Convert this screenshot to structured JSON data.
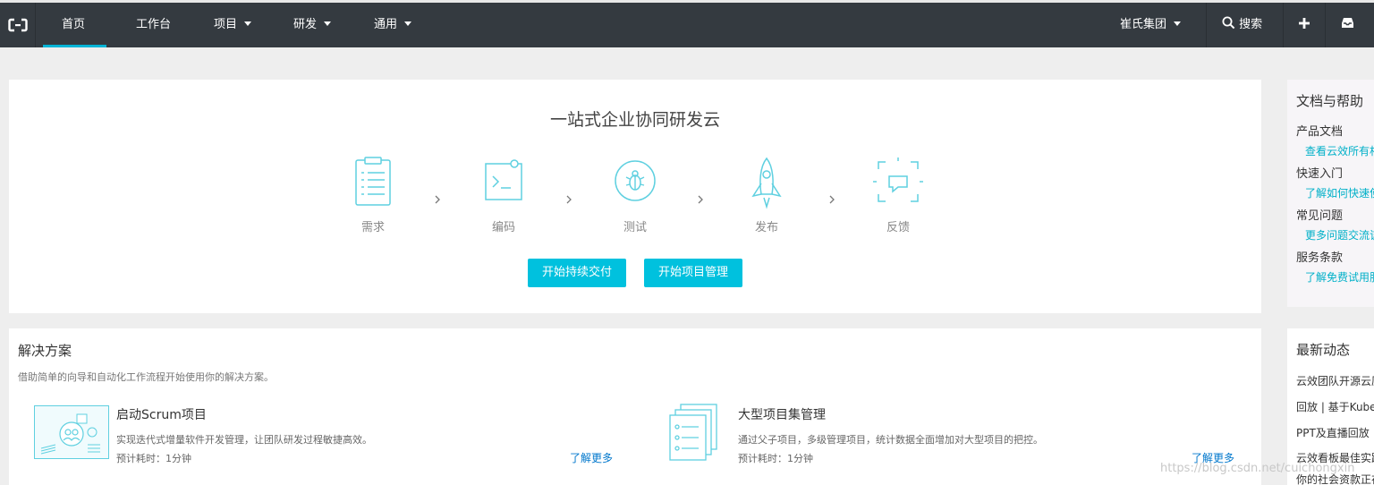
{
  "nav": {
    "items": [
      "首页",
      "工作台",
      "项目",
      "研发",
      "通用"
    ],
    "org": "崔氏集团",
    "search": "搜索"
  },
  "hero": {
    "title": "一站式企业协同研发云",
    "steps": [
      "需求",
      "编码",
      "测试",
      "发布",
      "反馈"
    ],
    "buttons": [
      "开始持续交付",
      "开始项目管理"
    ]
  },
  "solutions": {
    "title": "解决方案",
    "desc": "借助简单的向导和自动化工作流程开始使用你的解决方案。",
    "items": [
      {
        "title": "启动Scrum项目",
        "desc": "实现迭代式增量软件开发管理，让团队研发过程敏捷高效。",
        "time": "预计耗时：1分钟",
        "more": "了解更多"
      },
      {
        "title": "大型项目集管理",
        "desc": "通过父子项目，多级管理项目，统计数据全面增加对大型项目的把控。",
        "time": "预计耗时：1分钟",
        "more": "了解更多"
      }
    ]
  },
  "help": {
    "title": "文档与帮助",
    "groups": [
      {
        "heading": "产品文档",
        "link": "查看云效所有相"
      },
      {
        "heading": "快速入门",
        "link": "了解如何快速使"
      },
      {
        "heading": "常见问题",
        "link": "更多问题交流该"
      },
      {
        "heading": "服务条款",
        "link": "了解免费试用服"
      }
    ]
  },
  "news": {
    "title": "最新动态",
    "items": [
      "云效团队开源云原",
      "回放 | 基于Kubern",
      "PPT及直播回放 | ",
      "云效看板最佳实践",
      "你的社会资款正在"
    ]
  },
  "watermark": "https://blog.csdn.net/cuichongxin",
  "colors": {
    "accent": "#00c1de",
    "nav_bg": "#343a40",
    "link": "#0077cc"
  }
}
